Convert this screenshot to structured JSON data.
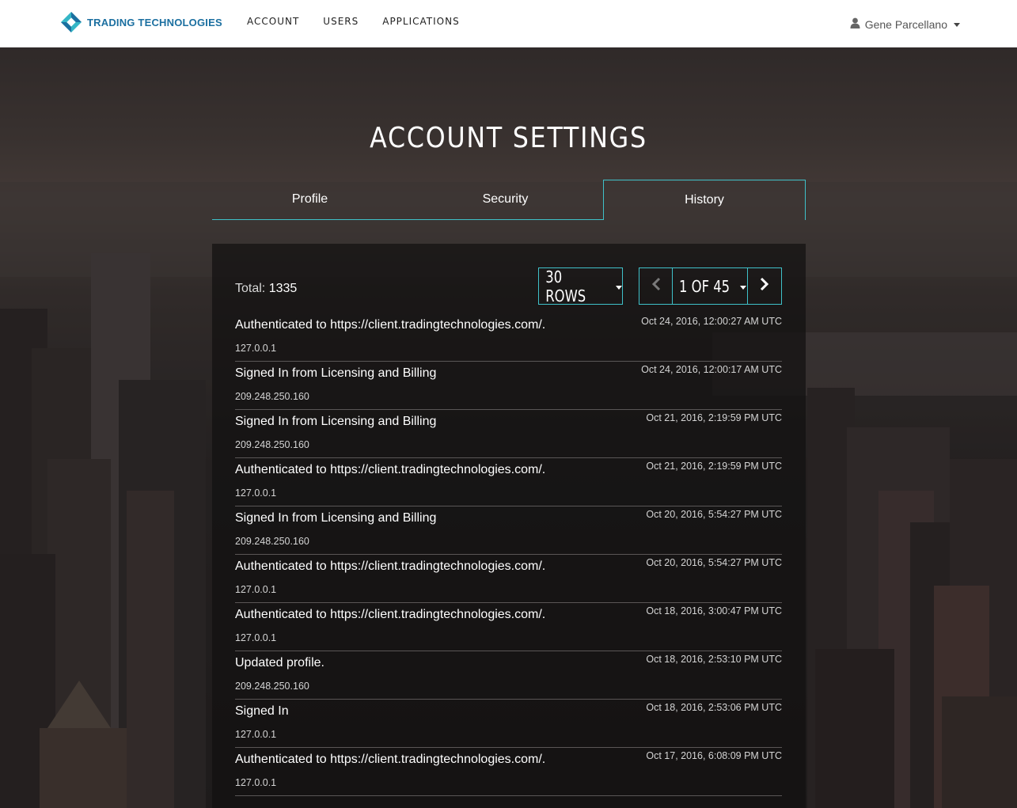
{
  "navbar": {
    "brand": "TRADING TECHNOLOGIES",
    "links": [
      {
        "label": "ACCOUNT"
      },
      {
        "label": "USERS"
      },
      {
        "label": "APPLICATIONS"
      }
    ],
    "user_name": "Gene Parcellano"
  },
  "page": {
    "title": "ACCOUNT SETTINGS"
  },
  "tabs": [
    {
      "label": "Profile"
    },
    {
      "label": "Security"
    },
    {
      "label": "History",
      "active": true
    }
  ],
  "history": {
    "total_label": "Total:",
    "total_value": "1335",
    "rows_button": "30 ROWS",
    "page_indicator": "1 OF 45",
    "items": [
      {
        "event": "Authenticated to https://client.tradingtechnologies.com/.",
        "ip": "127.0.0.1",
        "time": "Oct 24, 2016, 12:00:27 AM UTC"
      },
      {
        "event": "Signed In from Licensing and Billing",
        "ip": "209.248.250.160",
        "time": "Oct 24, 2016, 12:00:17 AM UTC"
      },
      {
        "event": "Signed In from Licensing and Billing",
        "ip": "209.248.250.160",
        "time": "Oct 21, 2016, 2:19:59 PM UTC"
      },
      {
        "event": "Authenticated to https://client.tradingtechnologies.com/.",
        "ip": "127.0.0.1",
        "time": "Oct 21, 2016, 2:19:59 PM UTC"
      },
      {
        "event": "Signed In from Licensing and Billing",
        "ip": "209.248.250.160",
        "time": "Oct 20, 2016, 5:54:27 PM UTC"
      },
      {
        "event": "Authenticated to https://client.tradingtechnologies.com/.",
        "ip": "127.0.0.1",
        "time": "Oct 20, 2016, 5:54:27 PM UTC"
      },
      {
        "event": "Authenticated to https://client.tradingtechnologies.com/.",
        "ip": "127.0.0.1",
        "time": "Oct 18, 2016, 3:00:47 PM UTC"
      },
      {
        "event": "Updated profile.",
        "ip": "209.248.250.160",
        "time": "Oct 18, 2016, 2:53:10 PM UTC"
      },
      {
        "event": "Signed In",
        "ip": "127.0.0.1",
        "time": "Oct 18, 2016, 2:53:06 PM UTC"
      },
      {
        "event": "Authenticated to https://client.tradingtechnologies.com/.",
        "ip": "127.0.0.1",
        "time": "Oct 17, 2016, 6:08:09 PM UTC"
      }
    ]
  },
  "icons": {
    "brand": "tt-diamond-logo-icon",
    "user": "user-icon",
    "prev": "chevron-left-icon",
    "next": "chevron-right-icon",
    "dropdown": "caret-down-icon"
  },
  "colors": {
    "accent": "#3fc1c9",
    "brand_blue": "#1b6fa0",
    "navbar_bg": "#ffffff"
  }
}
